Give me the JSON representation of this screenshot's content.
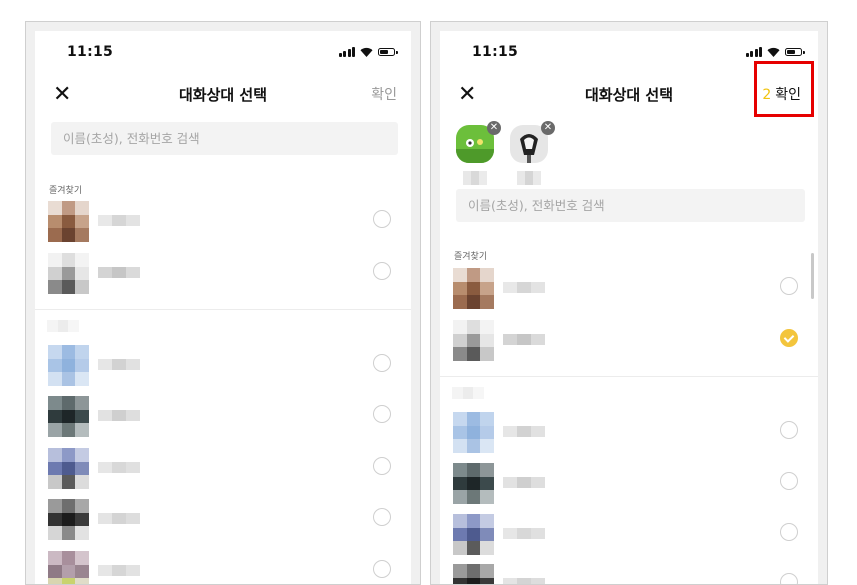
{
  "left": {
    "status_time": "11:15",
    "close_icon": "✕",
    "title": "대화상대 선택",
    "confirm_label": "확인",
    "search_placeholder": "이름(초성), 전화번호 검색",
    "favorites_label": "즐겨찾기"
  },
  "right": {
    "status_time": "11:15",
    "close_icon": "✕",
    "title": "대화상대 선택",
    "confirm_count": "2",
    "confirm_label": "확인",
    "remove_icon": "✕",
    "search_placeholder": "이름(초성), 전화번호 검색",
    "favorites_label": "즐겨찾기"
  },
  "colors": {
    "accent_yellow": "#f3c53d",
    "highlight_red": "#e60000",
    "divider": "#ececec"
  },
  "icons": [
    "close-icon",
    "signal-icon",
    "wifi-icon",
    "battery-icon",
    "check-icon",
    "remove-icon"
  ]
}
